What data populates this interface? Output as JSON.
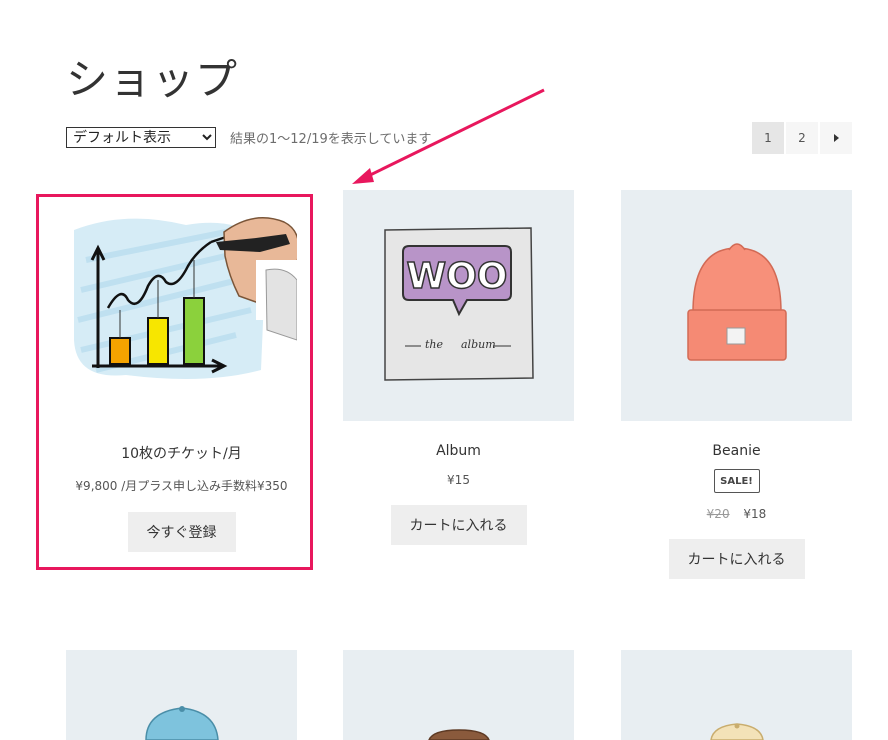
{
  "page": {
    "title": "ショップ"
  },
  "toolbar": {
    "sort_selected": "デフォルト表示",
    "result_count": "結果の1〜12/19を表示しています"
  },
  "pagination": {
    "pages": [
      "1",
      "2"
    ],
    "next_icon": "triangle-right-icon",
    "current": "1"
  },
  "products": [
    {
      "title": "10枚のチケット/月",
      "price": "¥9,800 /月プラス申し込み手数料¥350",
      "button": "今すぐ登録",
      "image": "chart-drawing-image"
    },
    {
      "title": "Album",
      "price": "¥15",
      "button": "カートに入れる",
      "image": "woo-album-image",
      "image_texts": [
        "WOO",
        "the",
        "album"
      ]
    },
    {
      "title": "Beanie",
      "badge": "SALE!",
      "old_price": "¥20",
      "price": "¥18",
      "button": "カートに入れる",
      "image": "beanie-image"
    }
  ],
  "second_row": [
    "cap-image",
    "hat-image",
    "cap-image"
  ],
  "annotations": {
    "highlight_color": "#e8175d"
  }
}
